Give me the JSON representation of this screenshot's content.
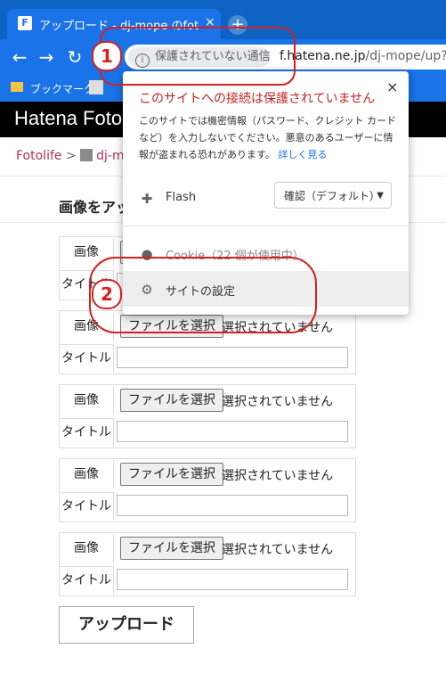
{
  "browser": {
    "tab_favicon": "F",
    "tab_title": "アップロード - dj-mope のfotolife",
    "tab_close": "×",
    "new_tab": "+",
    "back_icon": "←",
    "forward_icon": "→",
    "reload_icon": "↻",
    "security_chip": "保護されていない通信",
    "security_icon": "i",
    "url_host": "f.hatena.ne.jp",
    "url_path": "/dj-mope/up?fol",
    "bookmark_label": "ブックマーク"
  },
  "site": {
    "logo": "Hatena Fotolife",
    "breadcrumb_root": "Fotolife",
    "breadcrumb_sep": ">",
    "breadcrumb_user": "dj-mope",
    "heading": "画像をアップロード",
    "image_label": "画像",
    "title_label": "タイトル",
    "file_button": "ファイルを選択",
    "file_status": "選択されていません",
    "upload_button": "アップロード"
  },
  "popup": {
    "title": "このサイトへの接続は保護されていません",
    "close": "×",
    "description": "このサイトでは機密情報（パスワード、クレジット カードなど）を入力しないでください。悪意のあるユーザーに情報が盗まれる恐れがあります。",
    "learn_more": "詳しく見る",
    "flash_label": "Flash",
    "flash_value": "確認（デフォルト）",
    "cookie_label": "Cookie（22 個が使用中）",
    "settings_label": "サイトの設定"
  },
  "annotations": {
    "one": "1",
    "two": "2"
  },
  "colors": {
    "chrome_blue": "#1a73e8",
    "warning_red": "#c5221f",
    "annotation_red": "#d62020",
    "link_pink": "#b5305a"
  }
}
